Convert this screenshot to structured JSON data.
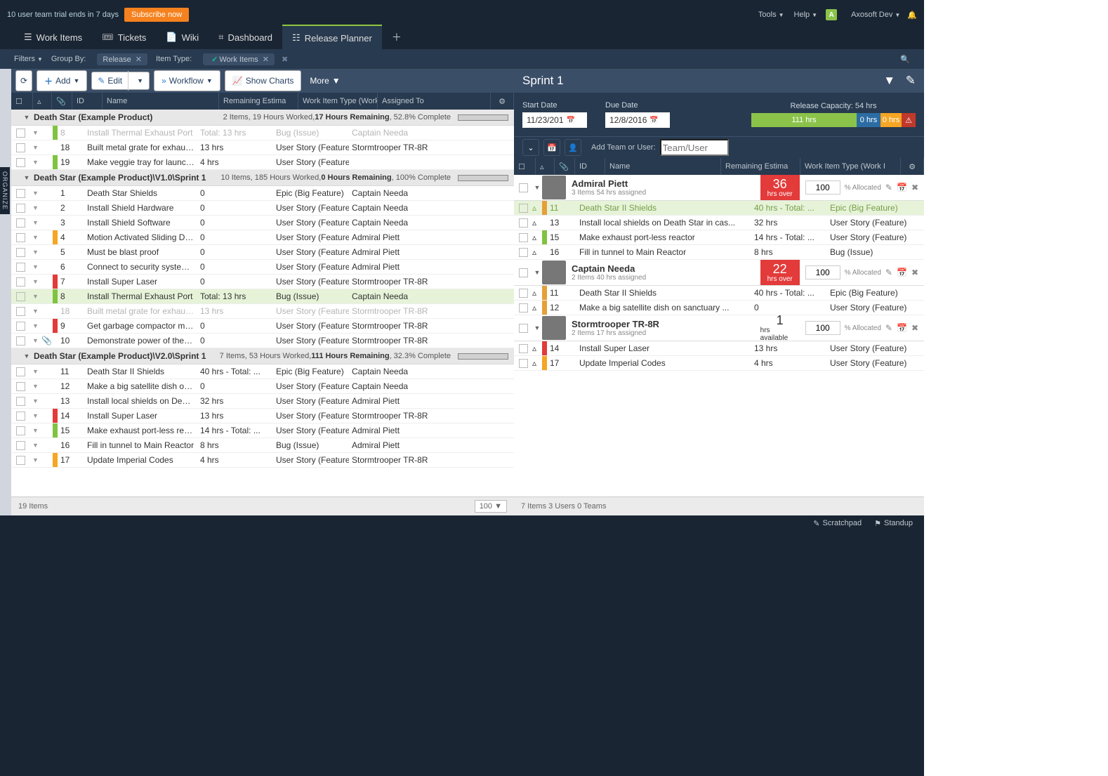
{
  "trial_text": "10 user team trial ends in 7 days",
  "subscribe": "Subscribe now",
  "topnav": {
    "tools": "Tools",
    "help": "Help",
    "user": "Axosoft Dev",
    "avatar": "A"
  },
  "tabs": {
    "work_items": "Work Items",
    "tickets": "Tickets",
    "wiki": "Wiki",
    "dashboard": "Dashboard",
    "release_planner": "Release Planner"
  },
  "filters": {
    "label": "Filters",
    "groupby": "Group By:",
    "release": "Release",
    "itemtype_lbl": "Item Type:",
    "itemtype_val": "Work Items"
  },
  "toolbar": {
    "add": "Add",
    "edit": "Edit",
    "workflow": "Workflow",
    "show_charts": "Show Charts",
    "more": "More"
  },
  "organize": "ORGANIZE",
  "columns": {
    "id": "ID",
    "name": "Name",
    "est": "Remaining Estima",
    "type": "Work Item Type (Work I",
    "assignee": "Assigned To"
  },
  "groups": [
    {
      "title": "Death Star (Example Product)",
      "summary_pre": "2 Items, 19 Hours Worked, ",
      "summary_bold": "17 Hours Remaining",
      "summary_post": ", 52.8% Complete",
      "progress": 52.8,
      "rows": [
        {
          "flag": "green",
          "id": "8",
          "name": "Install Thermal Exhaust Port",
          "est": "Total: 13 hrs",
          "type": "Bug (Issue)",
          "assignee": "Captain Needa",
          "exp": "▼",
          "muted": true,
          "indent": 0
        },
        {
          "flag": "",
          "id": "18",
          "name": "Built metal grate for exhaust p...",
          "est": "13 hrs",
          "type": "User Story (Feature)",
          "assignee": "Stormtrooper TR-8R",
          "indent": 1
        },
        {
          "flag": "green",
          "id": "19",
          "name": "Make veggie tray for launch party",
          "est": "4 hrs",
          "type": "User Story (Feature)",
          "assignee": "",
          "indent": 0
        }
      ]
    },
    {
      "title": "Death Star (Example Product)\\V1.0\\Sprint 1",
      "summary_pre": "10 Items, 185 Hours Worked, ",
      "summary_bold": "0 Hours Remaining",
      "summary_post": ", 100% Complete",
      "progress": 100,
      "rows": [
        {
          "flag": "",
          "id": "1",
          "name": "Death Star Shields",
          "est": "0",
          "type": "Epic (Big Feature)",
          "assignee": "Captain Needa"
        },
        {
          "flag": "",
          "id": "2",
          "name": "Install Shield Hardware",
          "est": "0",
          "type": "User Story (Feature)",
          "assignee": "Captain Needa"
        },
        {
          "flag": "",
          "id": "3",
          "name": "Install Shield Software",
          "est": "0",
          "type": "User Story (Feature)",
          "assignee": "Captain Needa"
        },
        {
          "flag": "orange",
          "id": "4",
          "name": "Motion Activated Sliding Doors",
          "est": "0",
          "type": "User Story (Feature)",
          "assignee": "Admiral Piett"
        },
        {
          "flag": "",
          "id": "5",
          "name": "Must be blast proof",
          "est": "0",
          "type": "User Story (Feature)",
          "assignee": "Admiral Piett"
        },
        {
          "flag": "",
          "id": "6",
          "name": "Connect to security system fo...",
          "est": "0",
          "type": "User Story (Feature)",
          "assignee": "Admiral Piett"
        },
        {
          "flag": "red",
          "id": "7",
          "name": "Install Super Laser",
          "est": "0",
          "type": "User Story (Feature)",
          "assignee": "Stormtrooper TR-8R"
        },
        {
          "flag": "green",
          "id": "8",
          "name": "Install Thermal Exhaust Port",
          "est": "Total: 13 hrs",
          "type": "Bug (Issue)",
          "assignee": "Captain Needa",
          "hl": true,
          "exp": "▼"
        },
        {
          "flag": "",
          "id": "18",
          "name": "Built metal grate for exhaust p...",
          "est": "13 hrs",
          "type": "User Story (Feature)",
          "assignee": "Stormtrooper TR-8R",
          "muted": true,
          "indent": 1
        },
        {
          "flag": "red",
          "id": "9",
          "name": "Get garbage compactor monste...",
          "est": "0",
          "type": "User Story (Feature)",
          "assignee": "Stormtrooper TR-8R"
        },
        {
          "flag": "",
          "id": "10",
          "name": "Demonstrate power of the Battl...",
          "est": "0",
          "type": "User Story (Feature)",
          "assignee": "Stormtrooper TR-8R",
          "att": true
        }
      ]
    },
    {
      "title": "Death Star (Example Product)\\V2.0\\Sprint 1",
      "summary_pre": "7 Items, 53 Hours Worked, ",
      "summary_bold": "111 Hours Remaining",
      "summary_post": ", 32.3% Complete",
      "progress": 32.3,
      "rows": [
        {
          "flag": "",
          "id": "11",
          "name": "Death Star II Shields",
          "est": "40 hrs - Total: ...",
          "type": "Epic (Big Feature)",
          "assignee": "Captain Needa"
        },
        {
          "flag": "",
          "id": "12",
          "name": "Make a big satellite dish on sa...",
          "est": "0",
          "type": "User Story (Feature)",
          "assignee": "Captain Needa",
          "indent": 1
        },
        {
          "flag": "",
          "id": "13",
          "name": "Install local shields on Death S...",
          "est": "32 hrs",
          "type": "User Story (Feature)",
          "assignee": "Admiral Piett",
          "indent": 1
        },
        {
          "flag": "red",
          "id": "14",
          "name": "Install Super Laser",
          "est": "13 hrs",
          "type": "User Story (Feature)",
          "assignee": "Stormtrooper TR-8R"
        },
        {
          "flag": "green",
          "id": "15",
          "name": "Make exhaust port-less reactor",
          "est": "14 hrs - Total: ...",
          "type": "User Story (Feature)",
          "assignee": "Admiral Piett"
        },
        {
          "flag": "",
          "id": "16",
          "name": "Fill in tunnel to Main Reactor",
          "est": "8 hrs",
          "type": "Bug (Issue)",
          "assignee": "Admiral Piett",
          "indent": 1
        },
        {
          "flag": "orange",
          "id": "17",
          "name": "Update Imperial Codes",
          "est": "4 hrs",
          "type": "User Story (Feature)",
          "assignee": "Stormtrooper TR-8R"
        }
      ]
    }
  ],
  "left_footer": {
    "count": "19 Items",
    "pagesize": "100"
  },
  "sprint": {
    "title": "Sprint 1",
    "start_lbl": "Start Date",
    "start_val": "11/23/201",
    "due_lbl": "Due Date",
    "due_val": "12/8/2016",
    "capacity_lbl": "Release Capacity: 54 hrs",
    "bar": {
      "green_lbl": "111 hrs",
      "blue_lbl": "0 hrs",
      "red_lbl": "0 hrs"
    }
  },
  "teambar": {
    "addlabel": "Add Team or User:",
    "placeholder": "Team/User"
  },
  "r_columns": {
    "id": "ID",
    "name": "Name",
    "est": "Remaining Estima",
    "type": "Work Item Type (Work I"
  },
  "users": [
    {
      "name": "Admiral Piett",
      "sub": "3 Items   54 hrs assigned",
      "stat_num": "36",
      "stat_lbl": "hrs over",
      "stat_color": "#e33a3a",
      "pct": "100",
      "pct_lbl": "% Allocated",
      "rows": [
        {
          "flag": "amber",
          "id": "11",
          "name": "Death Star II Shields",
          "est": "40 hrs - Total: ...",
          "type": "Epic (Big Feature)",
          "hl": true
        },
        {
          "flag": "",
          "id": "13",
          "name": "Install local shields on Death Star in cas...",
          "est": "32 hrs",
          "type": "User Story (Feature)",
          "indent": 1
        },
        {
          "flag": "green",
          "id": "15",
          "name": "Make exhaust port-less reactor",
          "est": "14 hrs - Total: ...",
          "type": "User Story (Feature)"
        },
        {
          "flag": "",
          "id": "16",
          "name": "Fill in tunnel to Main Reactor",
          "est": "8 hrs",
          "type": "Bug (Issue)",
          "indent": 1
        }
      ]
    },
    {
      "name": "Captain Needa",
      "sub": "2 Items   40 hrs assigned",
      "stat_num": "22",
      "stat_lbl": "hrs over",
      "stat_color": "#e33a3a",
      "pct": "100",
      "pct_lbl": "% Allocated",
      "rows": [
        {
          "flag": "amber",
          "id": "11",
          "name": "Death Star II Shields",
          "est": "40 hrs - Total: ...",
          "type": "Epic (Big Feature)"
        },
        {
          "flag": "amber",
          "id": "12",
          "name": "Make a big satellite dish on sanctuary ...",
          "est": "0",
          "type": "User Story (Feature)",
          "indent": 1
        }
      ]
    },
    {
      "name": "Stormtrooper TR-8R",
      "sub": "2 Items   17 hrs assigned",
      "stat_num": "1",
      "stat_lbl": "hrs available",
      "stat_color": "#ffffff",
      "stat_text": "#333",
      "pct": "100",
      "pct_lbl": "% Allocated",
      "rows": [
        {
          "flag": "red",
          "id": "14",
          "name": "Install Super Laser",
          "est": "13 hrs",
          "type": "User Story (Feature)"
        },
        {
          "flag": "orange",
          "id": "17",
          "name": "Update Imperial Codes",
          "est": "4 hrs",
          "type": "User Story (Feature)"
        }
      ]
    }
  ],
  "right_footer": "7 Items   3 Users   0 Teams",
  "bottom": {
    "scratchpad": "Scratchpad",
    "standup": "Standup"
  }
}
